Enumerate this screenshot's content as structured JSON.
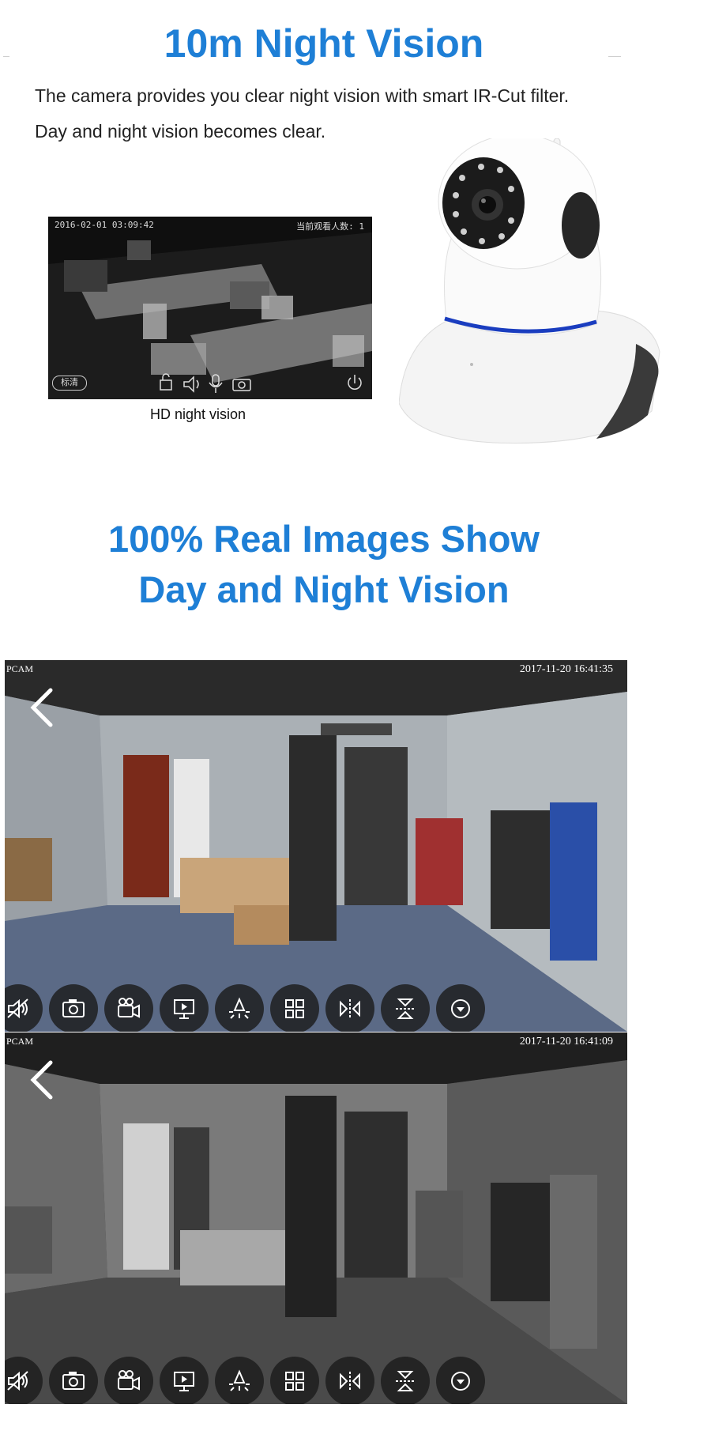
{
  "colors": {
    "accent": "#1e7fd6",
    "text": "#222222"
  },
  "section1": {
    "title": "10m Night Vision",
    "description_line1": "The camera provides you clear night vision with smart IR-Cut filter.",
    "description_line2": "Day and night vision becomes  clear.",
    "preview": {
      "timestamp": "2016-02-01  03:09:42",
      "viewers": "当前观看人数: 1",
      "quality_chip": "标清",
      "icons": [
        "lock-icon",
        "speaker-icon",
        "microphone-icon",
        "camera-icon",
        "power-icon"
      ]
    },
    "caption": "HD night vision"
  },
  "section2": {
    "title_line1": "100% Real Images  Show",
    "title_line2": "Day and Night Vision"
  },
  "frames": {
    "day": {
      "label": "PCAM",
      "timestamp": "2017-11-20  16:41:35"
    },
    "night": {
      "label": "PCAM",
      "timestamp": "2017-11-20  16:41:09"
    }
  },
  "toolbar_icons": [
    "mute-icon",
    "snapshot-icon",
    "record-icon",
    "video-playback-icon",
    "light-icon",
    "grid-icon",
    "flip-horizontal-icon",
    "flip-vertical-icon",
    "more-icon"
  ]
}
